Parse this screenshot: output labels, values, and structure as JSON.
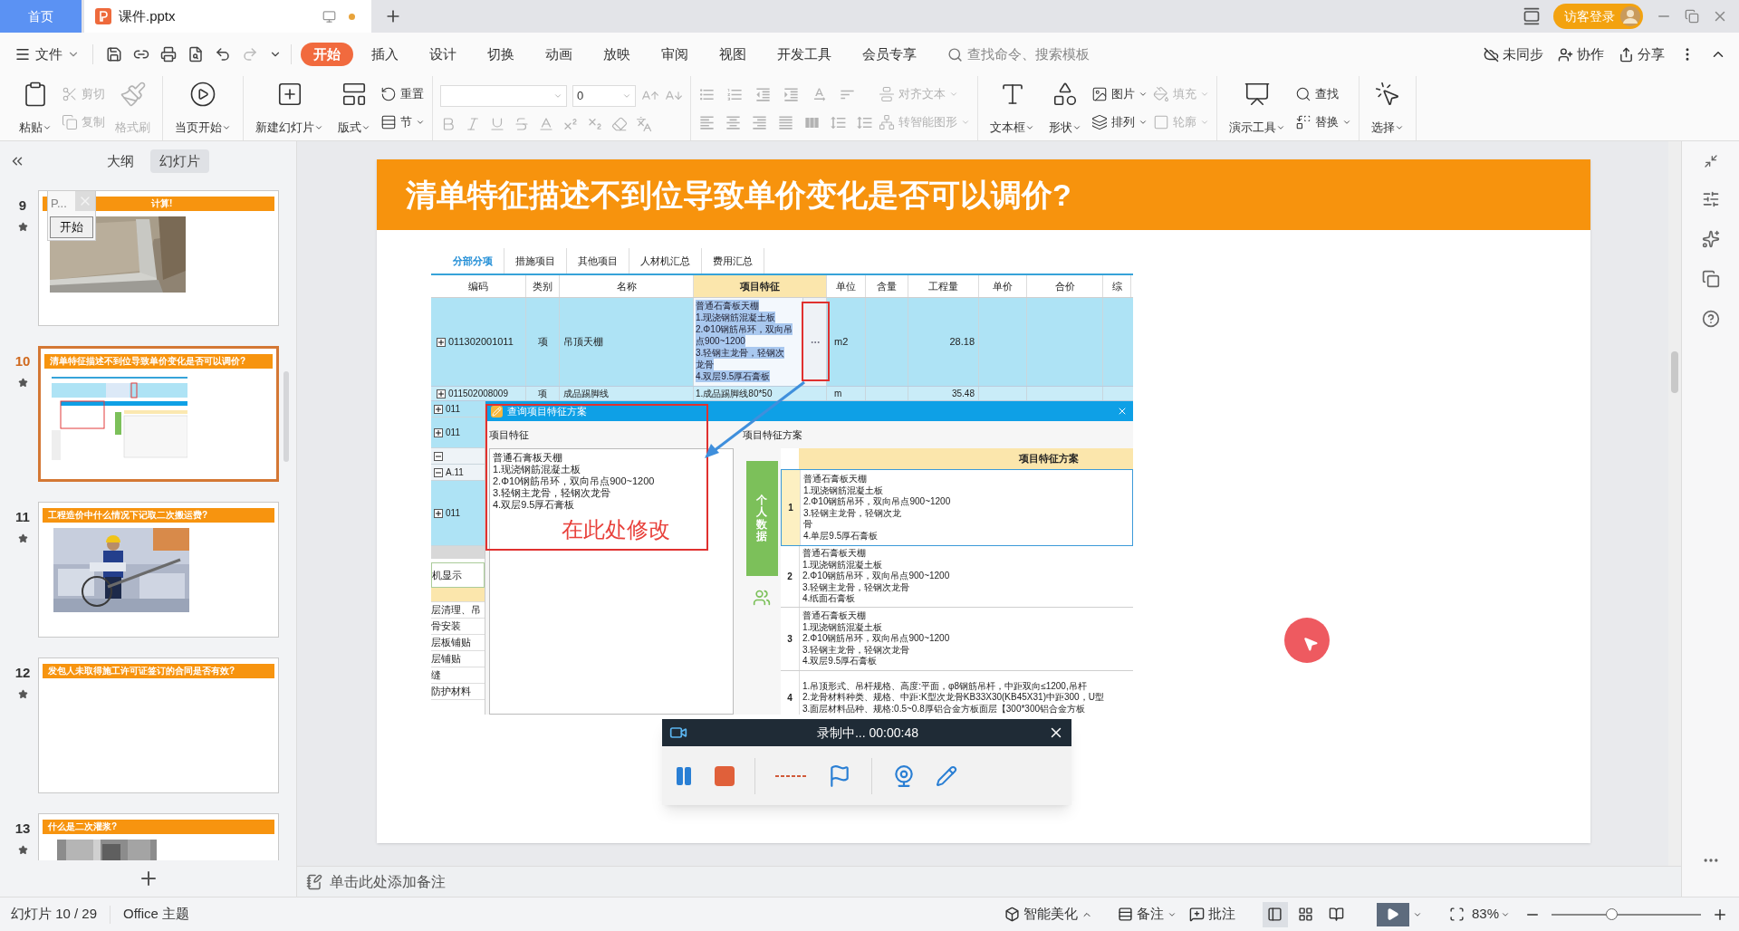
{
  "title_bar": {
    "tabs": [
      {
        "label": "首页",
        "selected": false,
        "kind": "home"
      },
      {
        "label": "课件.pptx",
        "selected": true,
        "kind": "document",
        "unsaved": true
      }
    ],
    "login": "访客登录"
  },
  "menu": {
    "file": "文件",
    "tabs": [
      {
        "label": "开始",
        "selected": true
      },
      {
        "label": "插入",
        "selected": false
      },
      {
        "label": "设计",
        "selected": false
      },
      {
        "label": "切换",
        "selected": false
      },
      {
        "label": "动画",
        "selected": false
      },
      {
        "label": "放映",
        "selected": false
      },
      {
        "label": "审阅",
        "selected": false
      },
      {
        "label": "视图",
        "selected": false
      },
      {
        "label": "开发工具",
        "selected": false
      },
      {
        "label": "会员专享",
        "selected": false
      }
    ],
    "search": {
      "placeholder": "查找命令、搜索模板"
    },
    "actions": [
      "未同步",
      "协作",
      "分享"
    ]
  },
  "ribbon": [
    {
      "items": [
        {
          "kind": "large",
          "label": "粘贴",
          "dropdown": true,
          "disabled": false
        },
        {
          "kind": "stack",
          "items": [
            {
              "label": "剪切",
              "dropdown": false,
              "disabled": true
            },
            {
              "label": "复制",
              "dropdown": false,
              "disabled": true
            }
          ]
        },
        {
          "kind": "large",
          "label": "格式刷",
          "dropdown": false,
          "disabled": true
        }
      ]
    },
    {
      "items": [
        {
          "kind": "large",
          "label": "当页开始",
          "dropdown": true,
          "disabled": false
        }
      ]
    },
    {
      "items": [
        {
          "kind": "large",
          "label": "新建幻灯片",
          "dropdown": true,
          "disabled": false
        },
        {
          "kind": "large",
          "label": "版式",
          "dropdown": true,
          "disabled": false
        },
        {
          "kind": "stack",
          "items": [
            {
              "label": "重置",
              "dropdown": false,
              "disabled": false
            },
            {
              "label": "节",
              "dropdown": true,
              "disabled": false
            }
          ]
        }
      ]
    },
    {
      "items": [
        {
          "kind": "font",
          "size": "0",
          "disabled": true
        }
      ]
    },
    {
      "items": [
        {
          "kind": "paragraph",
          "disabled": true
        },
        {
          "kind": "stack",
          "items": [
            {
              "label": "对齐文本",
              "dropdown": true,
              "disabled": true
            },
            {
              "label": "转智能图形",
              "dropdown": true,
              "disabled": true
            }
          ]
        }
      ]
    },
    {
      "items": [
        {
          "kind": "large",
          "label": "文本框",
          "dropdown": true,
          "disabled": false
        },
        {
          "kind": "large",
          "label": "形状",
          "dropdown": true,
          "disabled": false
        },
        {
          "kind": "stack",
          "items": [
            {
              "label": "图片",
              "dropdown": true,
              "disabled": false
            },
            {
              "label": "排列",
              "dropdown": true,
              "disabled": false
            }
          ]
        },
        {
          "kind": "stack",
          "items": [
            {
              "label": "填充",
              "dropdown": true,
              "disabled": true
            },
            {
              "label": "轮廓",
              "dropdown": true,
              "disabled": true
            }
          ]
        }
      ]
    },
    {
      "items": [
        {
          "kind": "large",
          "label": "演示工具",
          "dropdown": true,
          "disabled": false
        },
        {
          "kind": "stack",
          "items": [
            {
              "label": "查找",
              "dropdown": false,
              "disabled": false
            },
            {
              "label": "替换",
              "dropdown": true,
              "disabled": false
            }
          ]
        }
      ]
    },
    {
      "items": [
        {
          "kind": "large",
          "label": "选择",
          "dropdown": true,
          "disabled": false
        }
      ]
    }
  ],
  "slides_pane": {
    "tabs": [
      {
        "label": "大纲",
        "selected": false
      },
      {
        "label": "幻灯片",
        "selected": true
      }
    ],
    "slides": [
      {
        "number": "9",
        "title": "计算!",
        "selected": false,
        "kind": "picture"
      },
      {
        "number": "10",
        "title": "清单特征描述不到位导致单价变化是否可以调价?",
        "selected": true,
        "kind": "screenshot"
      },
      {
        "number": "11",
        "title": "工程造价中什么情况下记取二次搬运费?",
        "selected": false,
        "kind": "picture"
      },
      {
        "number": "12",
        "title": "发包人未取得施工许可证签订的合同是否有效?",
        "selected": false,
        "kind": "blank"
      },
      {
        "number": "13",
        "title": "什么是二次灌浆?",
        "selected": false,
        "kind": "picture"
      }
    ],
    "popup": {
      "title": "P...",
      "button": "开始"
    }
  },
  "slide": {
    "title": "清单特征描述不到位导致单价变化是否可以调价?",
    "app": {
      "tabs": [
        {
          "label": "分部分项",
          "selected": true
        },
        {
          "label": "措施项目",
          "selected": false
        },
        {
          "label": "其他项目",
          "selected": false
        },
        {
          "label": "人材机汇总",
          "selected": false
        },
        {
          "label": "费用汇总",
          "selected": false
        }
      ],
      "columns": [
        {
          "label": "编码",
          "highlighted": false
        },
        {
          "label": "类别",
          "highlighted": false
        },
        {
          "label": "名称",
          "highlighted": false
        },
        {
          "label": "项目特征",
          "highlighted": true
        },
        {
          "label": "单位",
          "highlighted": false
        },
        {
          "label": "含量",
          "highlighted": false
        },
        {
          "label": "工程量",
          "highlighted": false
        },
        {
          "label": "单价",
          "highlighted": false
        },
        {
          "label": "合价",
          "highlighted": false
        },
        {
          "label": "综",
          "highlighted": false
        }
      ],
      "rows": [
        {
          "expanded": false,
          "selected": true,
          "code": "011302001011",
          "type": "项",
          "name": "吊顶天棚",
          "feature": [
            "普通石膏板天棚",
            "1.现浇钢筋混凝土板",
            "2.Φ10钢筋吊环，双向吊",
            "点900~1200",
            "3.轻钢主龙骨，轻钢次",
            "龙骨",
            "4.双层9.5厚石膏板"
          ],
          "unit": "m2",
          "quantity": "28.18"
        },
        {
          "expanded": false,
          "selected": false,
          "code": "011502008009",
          "type": "项",
          "name": "成品踢脚线",
          "feature": [
            "1.成品踢脚线80*50"
          ],
          "unit": "m",
          "quantity": "35.48"
        }
      ],
      "left_strip": {
        "rows": [
          {
            "expanded": false,
            "text": "011"
          },
          {
            "expanded": false,
            "text": "011"
          },
          {
            "expanded": true
          },
          {
            "expanded": true,
            "text": "A.11"
          },
          {
            "expanded": false,
            "text": "011"
          }
        ],
        "panel_title": "机显示",
        "items": [
          "层清理、吊",
          "骨安装",
          "层板铺贴",
          "层铺贴",
          "缝",
          "防护材料"
        ]
      },
      "dialog": {
        "title": "查询项目特征方案",
        "feature_label": "项目特征",
        "feature_text": [
          "普通石膏板天棚",
          "1.现浇钢筋混凝土板",
          "2.Φ10钢筋吊环，双向吊点900~1200",
          "3.轻钢主龙骨，轻钢次龙骨",
          "4.双层9.5厚石膏板"
        ],
        "scheme_label": "项目特征方案",
        "side_tab": "个人数据",
        "table_header": "项目特征方案",
        "schemes": [
          {
            "number": "1",
            "selected": true,
            "lines": [
              "普通石膏板天棚",
              "1.现浇钢筋混凝土板",
              "2.Φ10钢筋吊环，双向吊点900~1200",
              "3.轻钢主龙骨，轻钢次龙",
              "骨",
              "4.单层9.5厚石膏板"
            ]
          },
          {
            "number": "2",
            "selected": false,
            "lines": [
              "普通石膏板天棚",
              "1.现浇钢筋混凝土板",
              "2.Φ10钢筋吊环，双向吊点900~1200",
              "3.轻钢主龙骨，轻钢次龙骨",
              "4.纸面石膏板"
            ]
          },
          {
            "number": "3",
            "selected": false,
            "lines": [
              "普通石膏板天棚",
              "1.现浇钢筋混凝土板",
              "2.Φ10钢筋吊环，双向吊点900~1200",
              "3.轻钢主龙骨，轻钢次龙骨",
              "4.双层9.5厚石膏板"
            ]
          },
          {
            "number": "4",
            "selected": false,
            "lines": [
              "1.吊顶形式、吊杆规格、高度:平面，φ8钢筋吊杆，中距双向≤1200,吊杆",
              "2.龙骨材料种类、规格、中距:K型次龙骨KB33X30(KB45X31)中距300，U型",
              "3.面层材料品种、规格:0.5~0.8厚铝合金方板面层【300*300铝合金方板"
            ]
          }
        ]
      }
    },
    "annotation": "在此处修改"
  },
  "recorder": {
    "title": "录制中... 00:00:48"
  },
  "notes": {
    "placeholder": "单击此处添加备注"
  },
  "status_bar": {
    "slide": "幻灯片 10 / 29",
    "theme": "Office 主题",
    "beautify": "智能美化",
    "notes": "备注",
    "comments": "批注",
    "views": [
      {
        "selected": true
      },
      {
        "selected": false
      },
      {
        "selected": false
      }
    ],
    "zoom": "83%",
    "zoom_slider": {
      "level": 0.4
    }
  }
}
